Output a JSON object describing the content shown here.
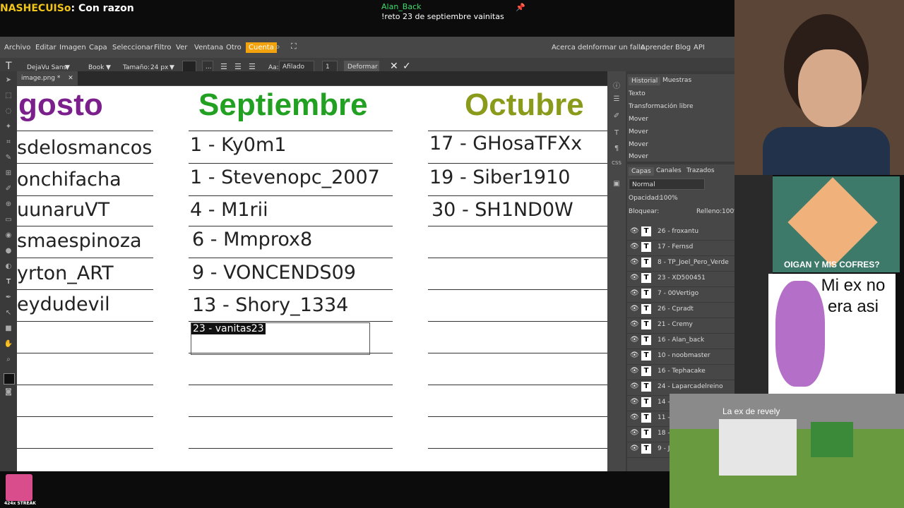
{
  "chat": {
    "left_user": "NASHECUISo",
    "left_message": ": Con razon",
    "mid_user": "Alan_Back",
    "mid_message": "!reto 23 de septiembre vainitas"
  },
  "menu": {
    "items": [
      "Archivo",
      "Editar",
      "Imagen",
      "Capa",
      "Seleccionar",
      "Filtro",
      "Ver",
      "Ventana",
      "Otro"
    ],
    "cuenta": "Cuenta",
    "right_items": [
      "Acerca de",
      "Informar un fallo",
      "Aprender",
      "Blog",
      "API"
    ]
  },
  "toolbar": {
    "font": "DejaVu Sans",
    "weight": "Book",
    "size_label": "Tamaño:",
    "size_value": "24 px",
    "more": "...",
    "aa_label": "Aa:",
    "aa_value": "Afilado",
    "spacing": "1",
    "deform": "Deformar"
  },
  "tab": {
    "name": "image.png *",
    "close": "✕"
  },
  "canvas": {
    "months": [
      {
        "name": "gosto",
        "color": "#7b1f8c"
      },
      {
        "name": "Septiembre",
        "color": "#22a022"
      },
      {
        "name": "Octubre",
        "color": "#8a9a1a"
      }
    ],
    "col1": [
      "sdelosmancos",
      "onchifacha",
      "uunaruVT",
      "smaespinoza",
      "yrton_ART",
      "eydudevil"
    ],
    "col2": [
      "1 - Ky0m1",
      "1 - Stevenopc_2007",
      "4 - M1rii",
      "6 - Mmprox8",
      "9 - VONCENDS09",
      "13 - Shory_1334"
    ],
    "col3": [
      "17 - GHosaTFXx",
      "19 - Siber1910",
      "30 - SH1ND0W"
    ],
    "editing_text": "23 - vanitas23"
  },
  "history": {
    "tabs": [
      "Historial",
      "Muestras"
    ],
    "items": [
      "Texto",
      "Transformación libre",
      "Mover",
      "Mover",
      "Mover",
      "Mover"
    ]
  },
  "layers": {
    "tabs": [
      "Capas",
      "Canales",
      "Trazados"
    ],
    "blend": "Normal",
    "opacity_label": "Opacidad:",
    "opacity": "100%",
    "lock_label": "Bloquear:",
    "fill_label": "Relleno:",
    "fill": "100%",
    "items": [
      "26 - froxantu",
      "17 - Fernsd",
      "8 - TP_Joel_Pero_Verde",
      "23 - XD500451",
      "7 - 00Vertigo",
      "26 - Cpradt",
      "21 - Cremy",
      "16 - Alan_back",
      "10 - noobmaster",
      "16 - Tephacake",
      "24 - Laparcadelreino",
      "14 -",
      "11 -",
      "18 -",
      "9 - J"
    ]
  },
  "overlays": {
    "meme1_caption": "OIGAN Y MIS COFRES?",
    "meme2_caption": "Mi ex no era asi",
    "meme3_caption": "La ex de revely",
    "streak": "424x STREAK"
  }
}
